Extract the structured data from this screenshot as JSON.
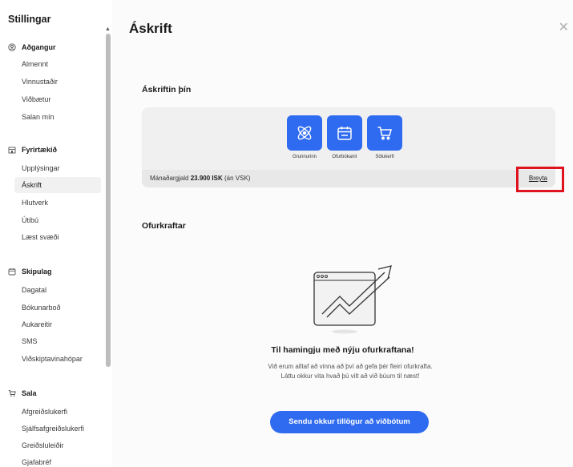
{
  "sidebar": {
    "title": "Stillingar",
    "sections": [
      {
        "label": "Aðgangur",
        "icon": "user-circle-icon",
        "items": [
          "Almennt",
          "Vinnustaðir",
          "Viðbætur",
          "Salan mín"
        ]
      },
      {
        "label": "Fyrirtækið",
        "icon": "building-icon",
        "items": [
          "Upplýsingar",
          "Áskrift",
          "Hlutverk",
          "Útibú",
          "Læst svæði"
        ]
      },
      {
        "label": "Skipulag",
        "icon": "calendar-icon",
        "items": [
          "Dagatal",
          "Bókunarboð",
          "Aukareitir",
          "SMS",
          "Viðskiptavinahópar"
        ]
      },
      {
        "label": "Sala",
        "icon": "cart-icon",
        "items": [
          "Afgreiðslukerfi",
          "Sjálfsafgreiðslukerfi",
          "Greiðsluleiðir",
          "Gjafabréf"
        ]
      }
    ],
    "active_item": "Áskrift"
  },
  "main": {
    "title": "Áskrift",
    "subscription_heading": "Áskriftin þín",
    "modules": [
      {
        "label": "Grunnurinn",
        "icon": "atom-icon"
      },
      {
        "label": "Ofurbókanir",
        "icon": "calendar-icon"
      },
      {
        "label": "Sölukerfi",
        "icon": "cart-icon"
      }
    ],
    "price_prefix": "Mánaðargjald",
    "price_value": "23.900 ISK",
    "price_suffix": "(án VSK)",
    "change_link": "Breyta",
    "superpowers_heading": "Ofurkraftar",
    "congrats_title": "Til hamingju með nýju ofurkraftana!",
    "congrats_text": "Við erum alltaf að vinna að því að gefa þér fleiri ofurkrafta. Láttu okkur vita hvað þú vilt að við búum til næst!",
    "cta_label": "Sendu okkur tillögur að viðbótum"
  },
  "colors": {
    "accent": "#2f6bf0",
    "highlight": "#e0141e"
  }
}
